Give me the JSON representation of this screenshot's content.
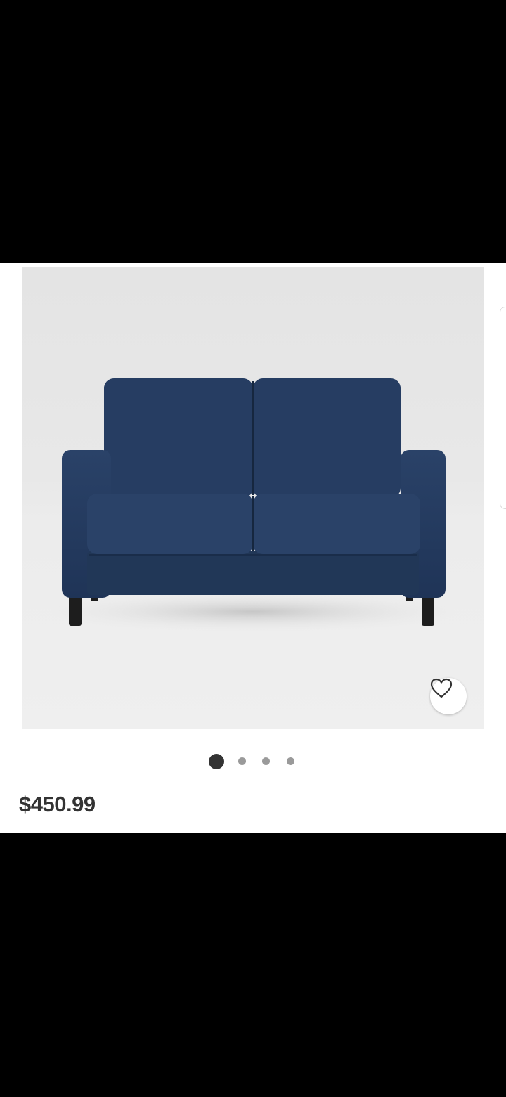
{
  "product": {
    "price": "$450.99",
    "image_pager": {
      "total": 4,
      "active_index": 0
    },
    "favorite_icon": "heart-outline-icon"
  },
  "colors": {
    "price_text": "#333333",
    "pager_active": "#333333",
    "pager_inactive": "#9a9a9a",
    "sofa": "#23395b"
  }
}
